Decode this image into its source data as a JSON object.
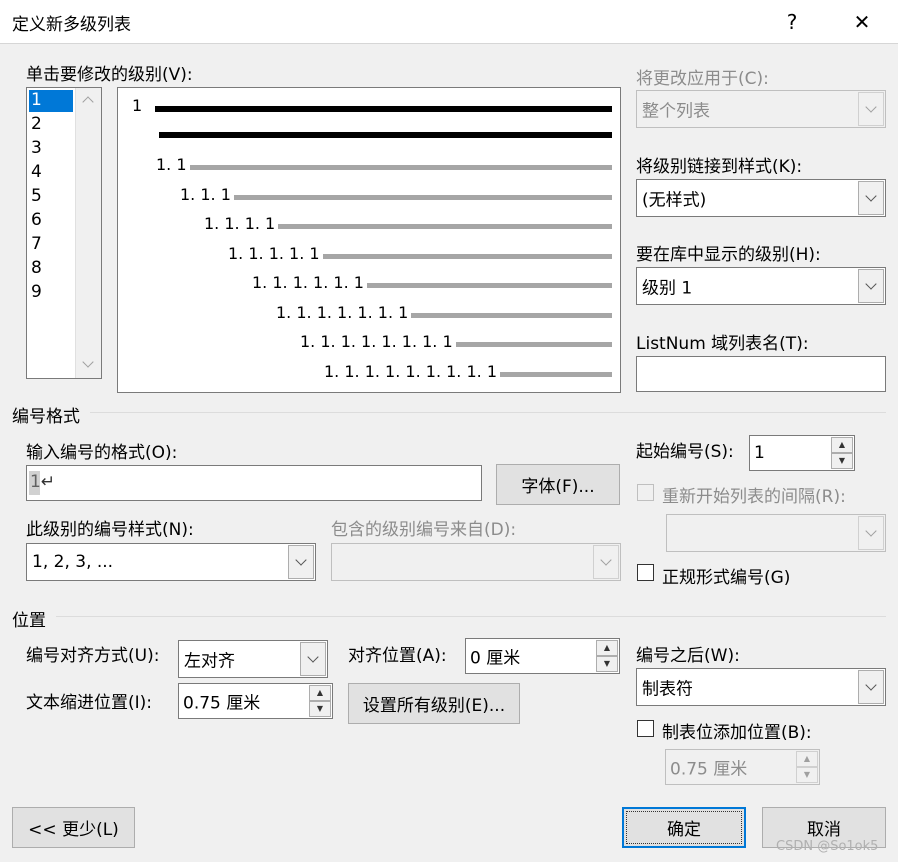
{
  "window": {
    "title": "定义新多级列表",
    "help": "?",
    "close": "✕"
  },
  "level_list": {
    "label": "单击要修改的级别(V):",
    "items": [
      "1",
      "2",
      "3",
      "4",
      "5",
      "6",
      "7",
      "8",
      "9"
    ],
    "selected": "1"
  },
  "preview": {
    "rows": [
      {
        "num": "1",
        "style": "black"
      },
      {
        "num": "",
        "style": "black"
      },
      {
        "num": "1. 1",
        "style": "gray"
      },
      {
        "num": "1. 1. 1",
        "style": "gray"
      },
      {
        "num": "1. 1. 1. 1",
        "style": "gray"
      },
      {
        "num": "1. 1. 1. 1. 1",
        "style": "gray"
      },
      {
        "num": "1. 1. 1. 1. 1. 1",
        "style": "gray"
      },
      {
        "num": "1. 1. 1. 1. 1. 1. 1",
        "style": "gray"
      },
      {
        "num": "1. 1. 1. 1. 1. 1. 1. 1",
        "style": "gray"
      },
      {
        "num": "1. 1. 1. 1. 1. 1. 1. 1. 1",
        "style": "gray"
      }
    ]
  },
  "right_panel": {
    "apply_to_label": "将更改应用于(C):",
    "apply_to_value": "整个列表",
    "link_style_label": "将级别链接到样式(K):",
    "link_style_value": "(无样式)",
    "gallery_level_label": "要在库中显示的级别(H):",
    "gallery_level_value": "级别 1",
    "listnum_label": "ListNum 域列表名(T):",
    "listnum_value": ""
  },
  "number_format": {
    "section": "编号格式",
    "enter_format_label": "输入编号的格式(O):",
    "enter_format_value": "1↵",
    "font_button": "字体(F)...",
    "style_label": "此级别的编号样式(N):",
    "style_value": "1, 2, 3, ...",
    "include_label": "包含的级别编号来自(D):",
    "include_value": "",
    "start_at_label": "起始编号(S):",
    "start_at_value": "1",
    "restart_label": "重新开始列表的间隔(R):",
    "restart_value": "",
    "legal_label": "正规形式编号(G)"
  },
  "position": {
    "section": "位置",
    "alignment_label": "编号对齐方式(U):",
    "alignment_value": "左对齐",
    "aligned_at_label": "对齐位置(A):",
    "aligned_at_value": "0 厘米",
    "indent_label": "文本缩进位置(I):",
    "indent_value": "0.75 厘米",
    "set_all_button": "设置所有级别(E)...",
    "follow_label": "编号之后(W):",
    "follow_value": "制表符",
    "tab_stop_label": "制表位添加位置(B):",
    "tab_stop_value": "0.75 厘米"
  },
  "footer": {
    "less_button": "<< 更少(L)",
    "ok_button": "确定",
    "cancel_button": "取消",
    "watermark": "CSDN @So1ok5"
  }
}
